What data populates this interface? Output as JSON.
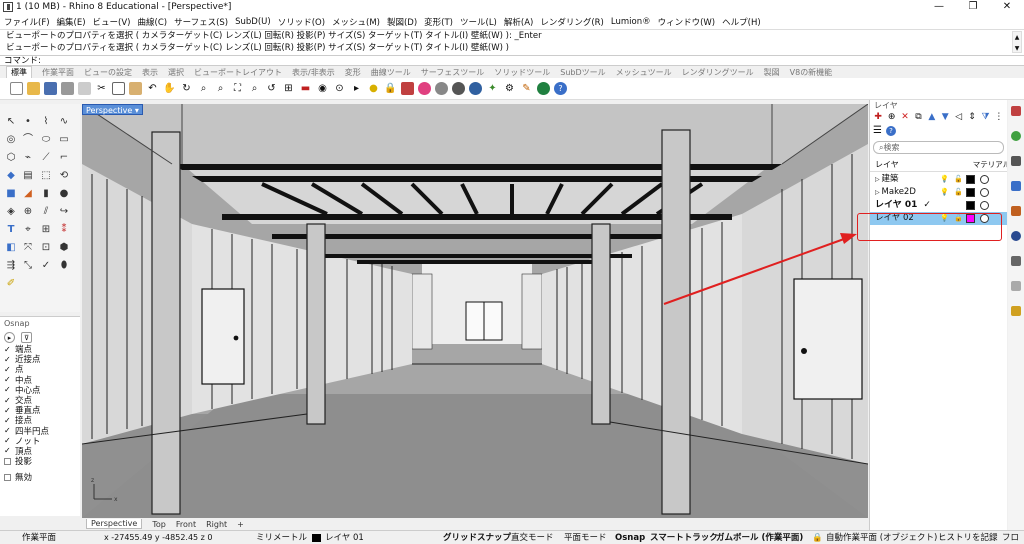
{
  "window": {
    "title": "1 (10 MB) - Rhino 8 Educational - [Perspective*]",
    "controls": [
      "—",
      "❐",
      "✕"
    ]
  },
  "menu": [
    "ファイル(F)",
    "編集(E)",
    "ビュー(V)",
    "曲線(C)",
    "サーフェス(S)",
    "SubD(U)",
    "ソリッド(O)",
    "メッシュ(M)",
    "製図(D)",
    "変形(T)",
    "ツール(L)",
    "解析(A)",
    "レンダリング(R)",
    "Lumion®",
    "ウィンドウ(W)",
    "ヘルプ(H)"
  ],
  "command": {
    "history": [
      "ビューポートのプロパティを選択 ( カメラターゲット(C)  レンズ(L)  回転(R)  投影(P)  サイズ(S)  ターゲット(T)  タイトル(I)  壁紙(W) ): _Enter",
      "ビューポートのプロパティを選択 ( カメラターゲット(C)  レンズ(L)  回転(R)  投影(P)  サイズ(S)  ターゲット(T)  タイトル(I)  壁紙(W) )"
    ],
    "prompt": "コマンド:"
  },
  "toolbar_tabs": [
    "標準",
    "作業平面",
    "ビューの設定",
    "表示",
    "選択",
    "ビューポートレイアウト",
    "表示/非表示",
    "変形",
    "曲線ツール",
    "サーフェスツール",
    "ソリッドツール",
    "SubDツール",
    "メッシュツール",
    "レンダリングツール",
    "製図",
    "V8の新機能"
  ],
  "active_tab": "標準",
  "viewport": {
    "label": "Perspective",
    "tabs": [
      "Perspective",
      "Top",
      "Front",
      "Right",
      "+"
    ]
  },
  "osnap": {
    "title": "Osnap",
    "items": [
      {
        "label": "端点",
        "checked": true
      },
      {
        "label": "近接点",
        "checked": true
      },
      {
        "label": "点",
        "checked": true
      },
      {
        "label": "中点",
        "checked": true
      },
      {
        "label": "中心点",
        "checked": true
      },
      {
        "label": "交点",
        "checked": true
      },
      {
        "label": "垂直点",
        "checked": true
      },
      {
        "label": "接点",
        "checked": true
      },
      {
        "label": "四半円点",
        "checked": true
      },
      {
        "label": "ノット",
        "checked": true
      },
      {
        "label": "頂点",
        "checked": true
      },
      {
        "label": "投影",
        "checked": false
      }
    ],
    "disable": "無効"
  },
  "layers": {
    "title": "レイヤ",
    "search_placeholder": "検索",
    "col_name": "レイヤ",
    "col_material": "マテリアル",
    "rows": [
      {
        "name": "建築",
        "prefix": "▷ ",
        "color": "#000000",
        "selected": false,
        "current": false
      },
      {
        "name": "Make2D",
        "prefix": "▷ ",
        "color": "#000000",
        "selected": false,
        "current": false
      },
      {
        "name": "レイヤ 01",
        "prefix": "",
        "color": "#000000",
        "selected": false,
        "current": true,
        "check": "✓"
      },
      {
        "name": "レイヤ 02",
        "prefix": "",
        "color": "#ff00ff",
        "selected": true,
        "current": false
      }
    ]
  },
  "status": {
    "cplane": "作業平面",
    "coords": "x -27455.49   y -4852.45   z 0",
    "units": "ミリメートル",
    "layer": "レイヤ 01",
    "toggles": [
      "グリッドスナップ",
      "直交モード",
      "平面モード",
      "Osnap",
      "スマートトラック",
      "ガムボール (作業平面)",
      "自動作業平面 (オブジェクト)",
      "ヒストリを記録",
      "フロ"
    ]
  }
}
